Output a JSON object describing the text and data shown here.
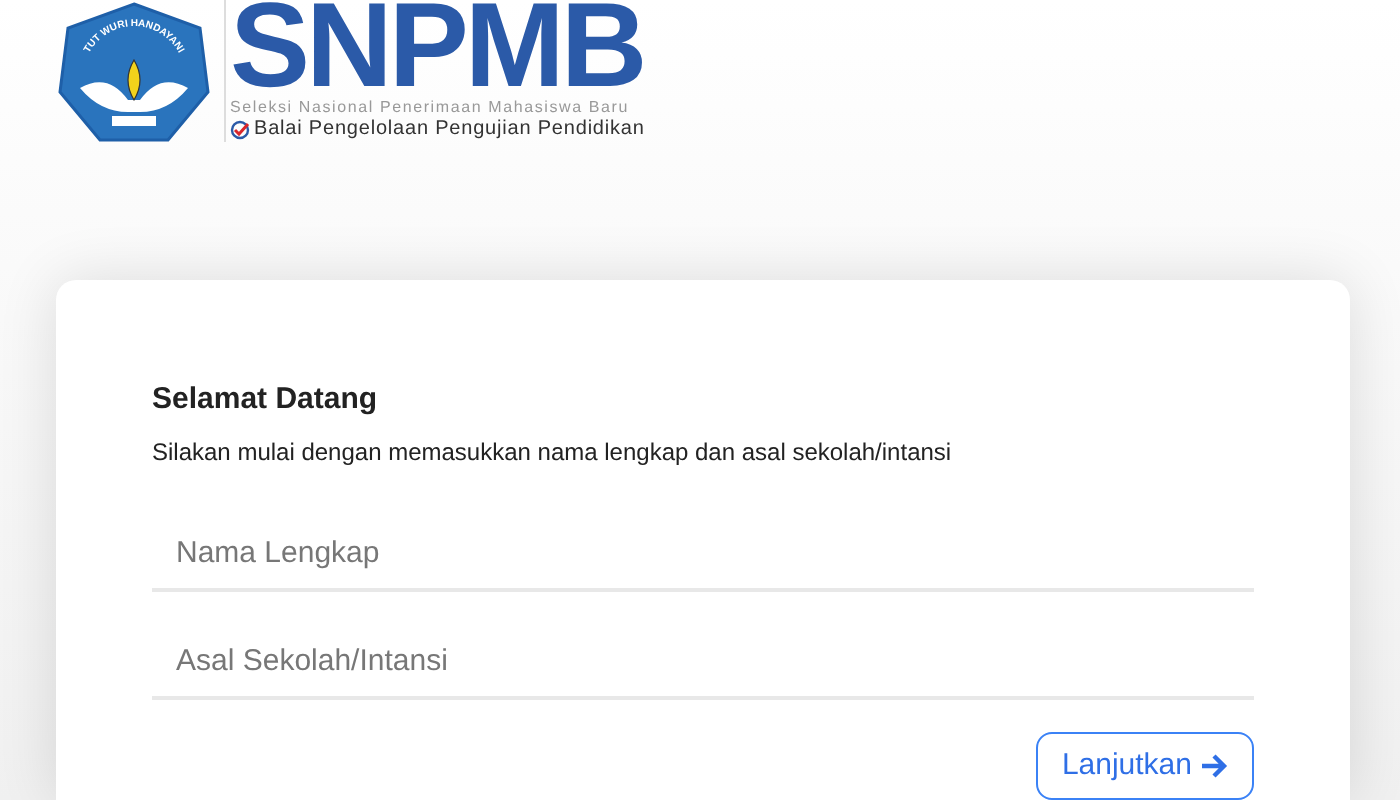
{
  "logo": {
    "emblem_motto": "TUT WURI HANDAYANI",
    "title": "SNPMB",
    "subtitle": "Seleksi Nasional Penerimaan Mahasiswa Baru",
    "agency": "Balai Pengelolaan Pengujian Pendidikan"
  },
  "card": {
    "heading": "Selamat Datang",
    "instruction": "Silakan mulai dengan memasukkan nama lengkap dan asal sekolah/intansi",
    "fields": [
      {
        "placeholder": "Nama Lengkap"
      },
      {
        "placeholder": "Asal Sekolah/Intansi"
      }
    ],
    "button": "Lanjutkan"
  }
}
